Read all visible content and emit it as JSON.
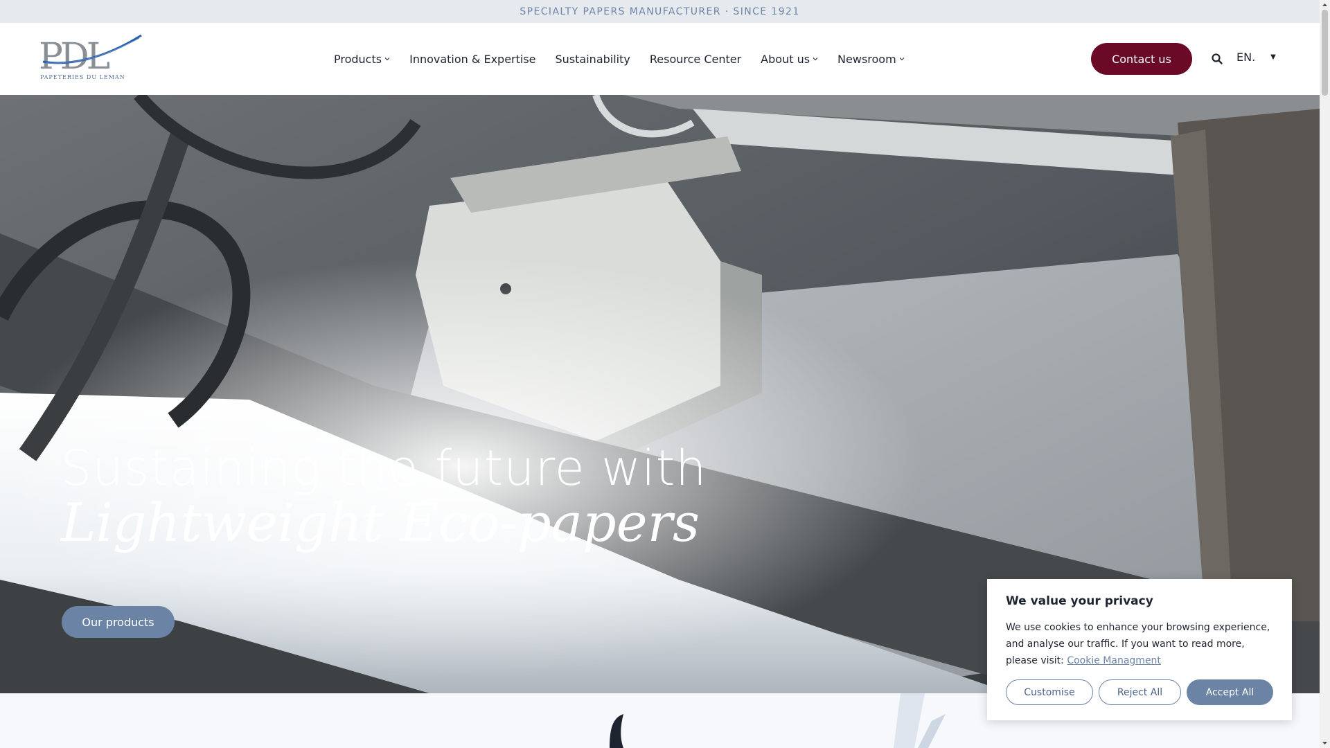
{
  "topbar": {
    "tagline": "SPECIALTY PAPERS MANUFACTURER · SINCE 1921"
  },
  "header": {
    "logo": {
      "wordmark": "PDL",
      "subtitle": "PAPETERIES DU LEMAN"
    },
    "nav": [
      {
        "label": "Products",
        "has_dropdown": true
      },
      {
        "label": "Innovation & Expertise",
        "has_dropdown": false
      },
      {
        "label": "Sustainability",
        "has_dropdown": false
      },
      {
        "label": "Resource Center",
        "has_dropdown": false
      },
      {
        "label": "About us",
        "has_dropdown": true
      },
      {
        "label": "Newsroom",
        "has_dropdown": true
      }
    ],
    "contact_label": "Contact us",
    "search_icon": "search-icon",
    "language": "EN."
  },
  "hero": {
    "title_line1": "Sustaining the future with",
    "title_line2": "Lightweight Eco-papers",
    "cta_label": "Our products"
  },
  "cookie": {
    "title": "We value your privacy",
    "text": "We use cookies to enhance your browsing experience, and analyse our traffic. If you want to read more, please visit:",
    "link_label": "Cookie Managment",
    "customise_label": "Customise",
    "reject_label": "Reject All",
    "accept_label": "Accept All"
  },
  "colors": {
    "brand_primary": "#6b0a27",
    "accent_blue": "#6b84a6",
    "topbar_bg": "#e6e9ed",
    "text_dark": "#1e2330"
  }
}
